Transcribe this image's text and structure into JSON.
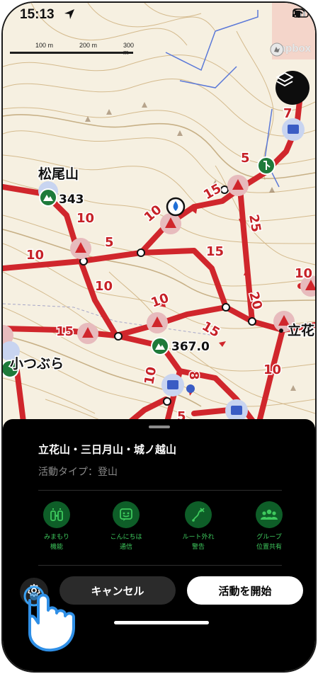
{
  "status_bar": {
    "time": "15:13"
  },
  "map": {
    "scale_labels": [
      "100 m",
      "200 m",
      "300 m"
    ],
    "attribution": "mapbox",
    "peaks": [
      {
        "name": "松尾山",
        "elevation": "343"
      },
      {
        "name": "小つぶら",
        "elevation": ""
      },
      {
        "name": "立花",
        "elevation": ""
      },
      {
        "name": "",
        "elevation": "367.0"
      }
    ],
    "segment_times": [
      "7",
      "5",
      "15",
      "25",
      "10",
      "5",
      "10",
      "15",
      "20",
      "10",
      "15",
      "8",
      "10",
      "10",
      "15",
      "5",
      "10",
      "15",
      "5"
    ]
  },
  "sheet": {
    "route_title": "立花山・三日月山・城ノ越山",
    "activity_type": "活動タイプ：登山",
    "features": [
      {
        "label": "みまもり\n機能",
        "icon": "bottle-icon"
      },
      {
        "label": "こんにちは\n通信",
        "icon": "greeting-icon"
      },
      {
        "label": "ルート外れ\n警告",
        "icon": "route-warning-icon"
      },
      {
        "label": "グループ\n位置共有",
        "icon": "group-icon"
      }
    ],
    "cancel_label": "キャンセル",
    "start_label": "活動を開始"
  },
  "colors": {
    "route": "#d0262c",
    "accent_green": "#3ec95d",
    "sheet_bg": "#000000"
  }
}
